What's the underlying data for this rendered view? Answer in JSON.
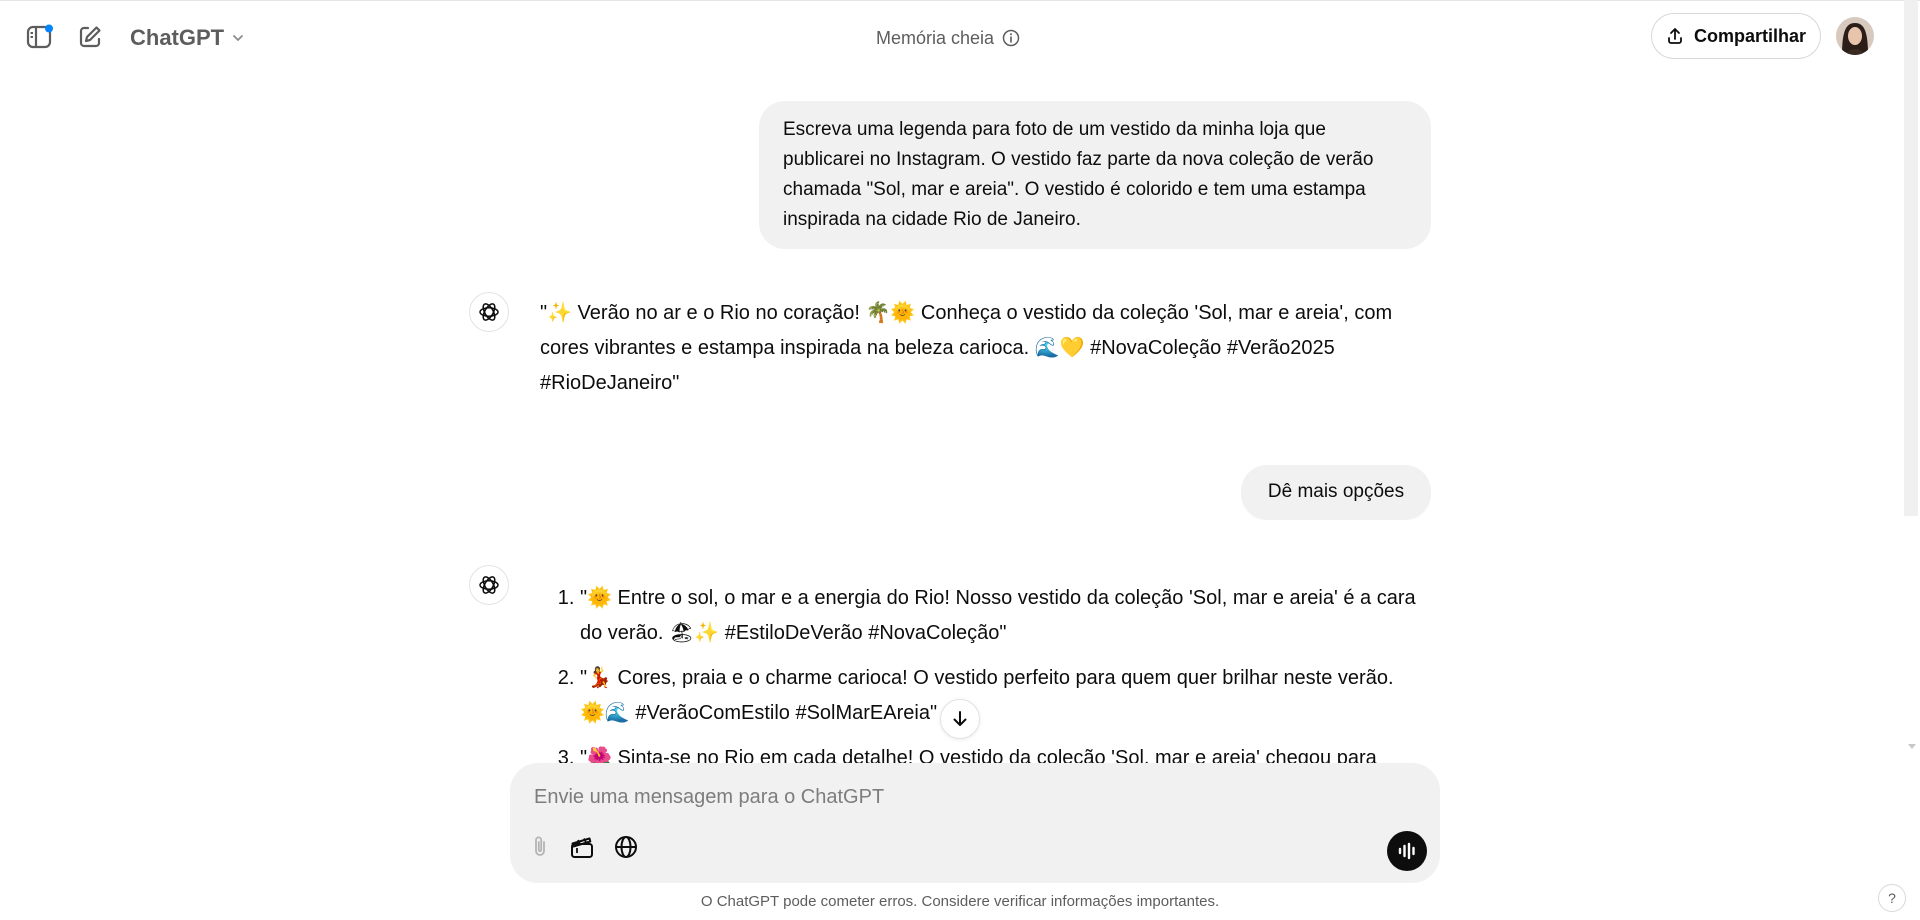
{
  "header": {
    "model_name": "ChatGPT",
    "memory_status": "Memória cheia",
    "share_label": "Compartilhar"
  },
  "conversation": {
    "user_message_1": "Escreva uma legenda para foto de um vestido da minha loja que publicarei no Instagram. O vestido faz parte da nova coleção de verão chamada \"Sol, mar e areia\". O vestido é colorido e tem uma estampa inspirada na cidade Rio de Janeiro.",
    "assistant_reply_1": "\"✨ Verão no ar e o Rio no coração! 🌴🌞 Conheça o vestido da coleção 'Sol, mar e areia', com cores vibrantes e estampa inspirada na beleza carioca. 🌊💛 #NovaColeção #Verão2025 #RioDeJaneiro\"",
    "user_message_2": "Dê mais opções",
    "assistant_reply_2": [
      "\"🌞 Entre o sol, o mar e a energia do Rio! Nosso vestido da coleção 'Sol, mar e areia' é a cara do verão. 🏖✨ #EstiloDeVerão #NovaColeção\"",
      "\"💃 Cores, praia e o charme carioca! O vestido perfeito para quem quer brilhar neste verão. 🌞🌊 #VerãoComEstilo #SolMarEAreia\"",
      "\"🌺 Sinta-se no Rio em cada detalhe! O vestido da coleção 'Sol, mar e areia' chegou para"
    ]
  },
  "composer": {
    "placeholder": "Envie uma mensagem para o ChatGPT"
  },
  "footer": {
    "disclaimer": "O ChatGPT pode cometer erros. Considere verificar informações importantes.",
    "help_label": "?"
  },
  "icons": {
    "sidebar_toggle": "sidebar-toggle-icon",
    "new_chat": "edit-icon",
    "chevron": "chevron-down-icon",
    "info": "info-icon",
    "share": "upload-icon",
    "assistant": "openai-logo-icon",
    "scroll_down": "arrow-down-icon",
    "attach": "paperclip-icon",
    "tools": "clapperboard-icon",
    "search": "globe-icon",
    "voice": "audio-waveform-icon"
  },
  "colors": {
    "bubble_bg": "#f1f1f1",
    "notification_dot": "#0285ff",
    "voice_button": "#0d0d0d"
  }
}
